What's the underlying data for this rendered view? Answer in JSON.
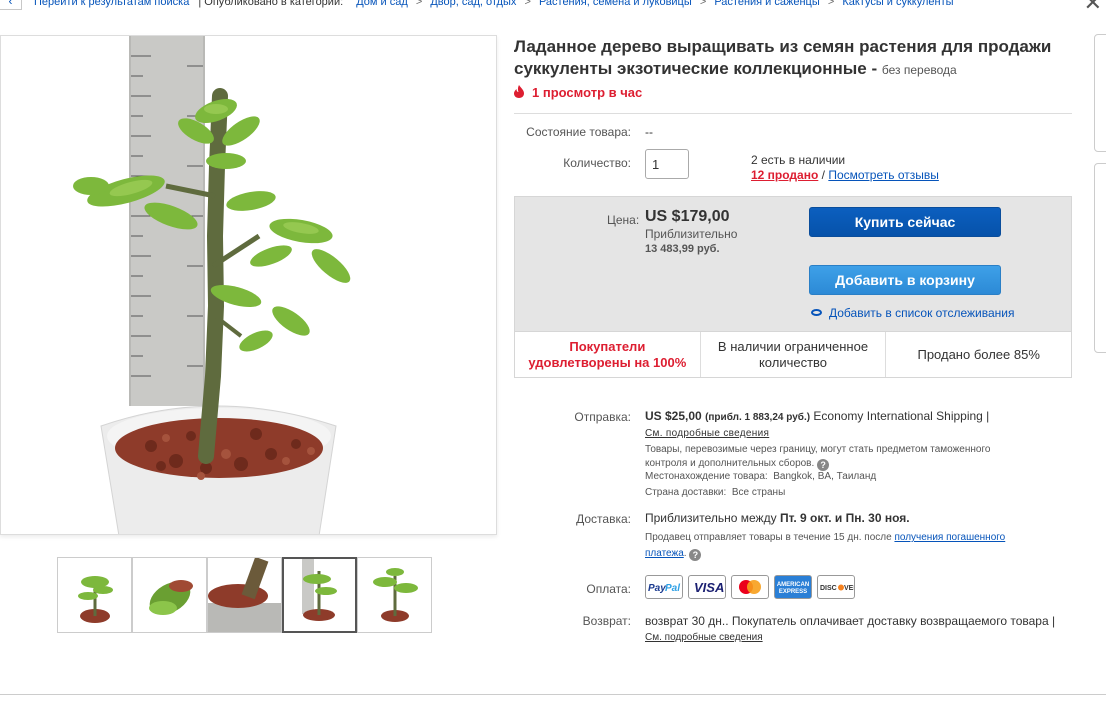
{
  "breadcrumb": {
    "back_arrow": "‹",
    "return_link": "Перейти к результатам поиска",
    "published_in": "| Опубликовано в категории:",
    "path": [
      "Дом и сад",
      "Двор, сад, отдых",
      "Растения, семена и луковицы",
      "Растения и саженцы",
      "Кактусы и суккуленты"
    ],
    "close": "✕"
  },
  "listing": {
    "title": "Ладанное дерево выращивать из семян растения для продажи суккуленты экзотические коллекционные - ",
    "title_note": "без перевода",
    "views": "1 просмотр в час",
    "condition_label": "Состояние товара:",
    "condition_value": "--",
    "quantity_label": "Количество:",
    "quantity_value": "1",
    "available": "2 есть в наличии",
    "sold": "12 продано",
    "divider": "/",
    "reviews_link": "Посмотреть отзывы"
  },
  "price_box": {
    "price_label": "Цена:",
    "price": "US $179,00",
    "approx_label": "Приблизительно",
    "approx_value": "13 483,99 руб.",
    "buy_button": "Купить сейчас",
    "cart_button": "Добавить в корзину",
    "watch_link": "Добавить в список отслеживания",
    "features": [
      "Покупатели удовлетворены на 100%",
      "В наличии ограниченное количество",
      "Продано более 85%"
    ]
  },
  "shipping": {
    "label": "Отправка:",
    "price": "US $25,00",
    "approx": "(прибл. 1 883,24 руб.)",
    "method": "Economy International Shipping |",
    "details_link": "См. подробные сведения",
    "customs_note": "Товары, перевозимые через границу, могут стать предметом таможенного контроля и дополнительных сборов.",
    "location_label": "Местонахождение товара:",
    "location_value": "Bangkok, BA, Таиланд",
    "ships_to_label": "Страна доставки:",
    "ships_to_value": "Все страны"
  },
  "delivery": {
    "label": "Доставка:",
    "prefix": "Приблизительно между",
    "range": "Пт. 9 окт. и Пн. 30 ноя.",
    "note": "Продавец отправляет товары в течение 15 дн. после",
    "note_link": "получения погашенного платежа",
    "note_end": "."
  },
  "payment": {
    "label": "Оплата:",
    "methods": [
      "PayPal",
      "VISA",
      "MasterCard",
      "American Express",
      "DISCOVER"
    ]
  },
  "returns": {
    "label": "Возврат:",
    "text": "возврат 30 дн..  Покупатель оплачивает доставку возвращаемого товара |",
    "details_link": "См. подробные сведения"
  },
  "colors": {
    "link": "#0654ba",
    "alert_red": "#dd1e31",
    "buy_blue": "#0654ba",
    "cart_blue": "#3498db"
  }
}
